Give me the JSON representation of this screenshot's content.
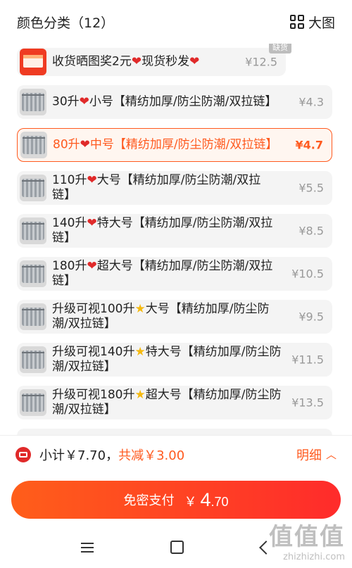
{
  "header": {
    "title": "颜色分类（12）",
    "view_label": "大图"
  },
  "items": [
    {
      "label": "收货晒图奖2元❤️现货秒发❤️",
      "price": "¥12.5",
      "badge": "缺货"
    },
    {
      "label": "30升❤️小号【精纺加厚/防尘防潮/双拉链】",
      "price": "¥4.3"
    },
    {
      "label": "80升❤️中号【精纺加厚/防尘防潮/双拉链】",
      "price": "¥4.7",
      "selected": true
    },
    {
      "label": "110升❤️大号【精纺加厚/防尘防潮/双拉链】",
      "price": "¥5.5"
    },
    {
      "label": "140升❤️特大号【精纺加厚/防尘防潮/双拉链】",
      "price": "¥8.5"
    },
    {
      "label": "180升❤️超大号【精纺加厚/防尘防潮/双拉链】",
      "price": "¥10.5"
    },
    {
      "label": "升级可视100升⭐大号【精纺加厚/防尘防潮/双拉链】",
      "price": "¥9.5"
    },
    {
      "label": "升级可视140升⭐特大号【精纺加厚/防尘防潮/双拉链】",
      "price": "¥11.5"
    },
    {
      "label": "升级可视180升⭐超大号【精纺加厚/防尘防潮/双拉链】",
      "price": "¥13.5"
    }
  ],
  "subtotal": {
    "label": "小计￥7.70，",
    "discount": "共减￥3.00",
    "detail": "明细"
  },
  "pay": {
    "label": "免密支付",
    "currency": "￥",
    "amount_int": "4",
    "amount_dec": ".70"
  },
  "watermark": {
    "mark": "值值值",
    "url": "zhizhizhi.com"
  },
  "colors": {
    "accent": "#ff5a1f",
    "heart": "#e02a2a"
  }
}
